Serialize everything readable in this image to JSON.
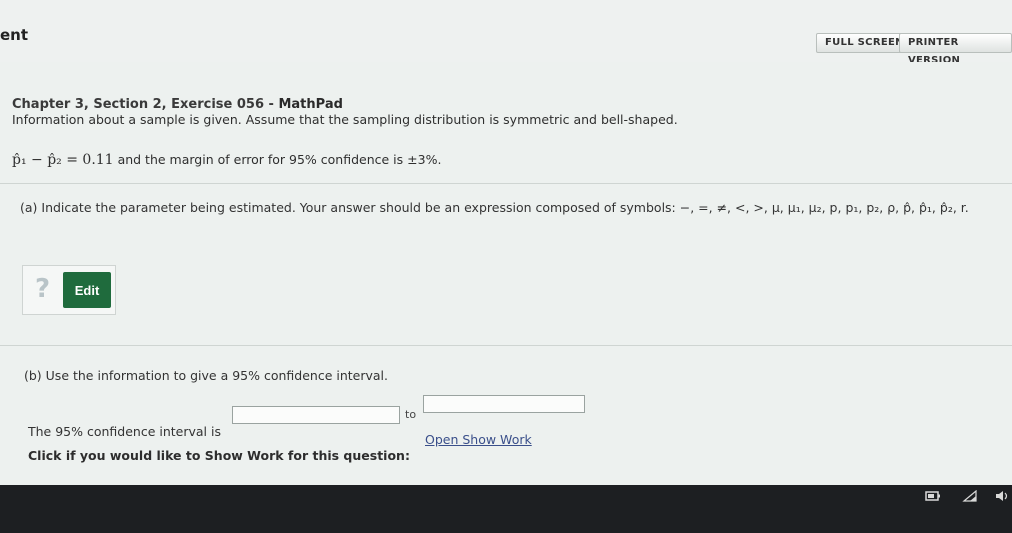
{
  "header": {
    "brand": "ent",
    "full_screen": "FULL SCREEN",
    "printer_version": "PRINTER VERSION"
  },
  "exercise": {
    "title": "Chapter 3, Section 2, Exercise 056",
    "separator": " - ",
    "tool": "MathPad",
    "info": "Information about a sample is given. Assume that the sampling distribution is symmetric and bell-shaped.",
    "given_expression": "p̂₁ − p̂₂ = 0.11",
    "given_text": " and the margin of error for 95% confidence is ±3%."
  },
  "part_a": {
    "prompt": "(a) Indicate the parameter being estimated. Your answer should be an expression composed of symbols: −, =, ≠, <, >, μ, μ₁, μ₂, p, p₁, p₂, ρ, p̂, p̂₁, p̂₂, r.",
    "help_symbol": "?",
    "edit_label": "Edit"
  },
  "part_b": {
    "prompt": "(b) Use the information to give a 95% confidence interval.",
    "ci_label": "The 95% confidence interval is",
    "to_label": "to",
    "ci_low_value": "",
    "ci_high_value": ""
  },
  "show_work": {
    "prompt": "Click if you would like to Show Work for this question:",
    "link": "Open Show Work"
  },
  "tray": {
    "network_icon": "battery-icon",
    "wifi_icon": "wifi-icon",
    "volume_icon": "volume-icon"
  }
}
